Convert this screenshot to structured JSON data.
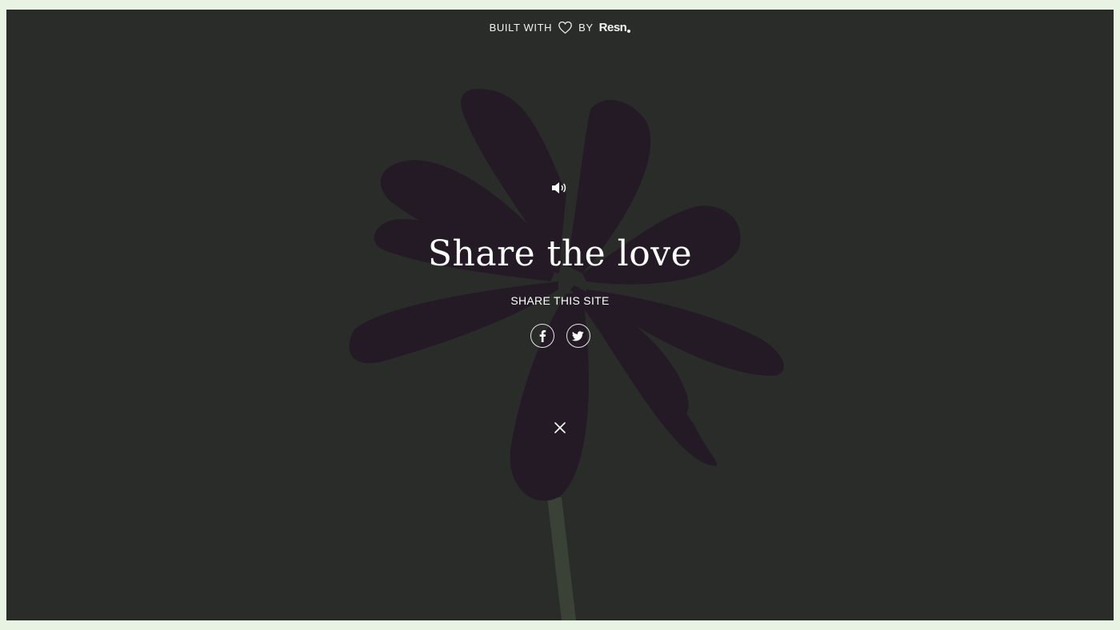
{
  "credit": {
    "prefix": "BUILT WITH",
    "icon": "heart-icon",
    "by": "BY",
    "brand": "Resn"
  },
  "overlay": {
    "sound_icon": "speaker-icon",
    "title": "Share the love",
    "subtitle": "SHARE THIS SITE",
    "social": [
      {
        "name": "facebook",
        "icon": "facebook-icon"
      },
      {
        "name": "twitter",
        "icon": "twitter-icon"
      }
    ],
    "close_icon": "close-icon"
  },
  "colors": {
    "frame_border": "#e8f3e4",
    "background": "#2a2c29",
    "petals": "#231a26",
    "stem": "#3a4238",
    "text": "#ffffff"
  }
}
